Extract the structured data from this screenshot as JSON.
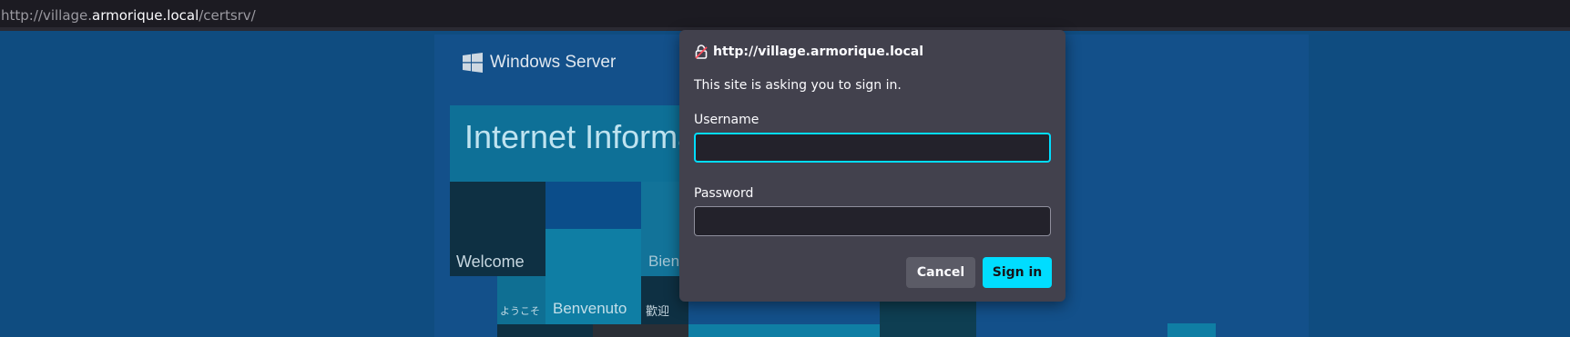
{
  "address_bar": {
    "url_prefix": "http://village.",
    "url_host": "armorique.local",
    "url_suffix": "/certsrv/"
  },
  "backdrop": {
    "brand": "Windows Server",
    "header": "Internet Information Services",
    "tiles": {
      "welcome": "Welcome",
      "bienvenue": "Bienvenue",
      "youkoso": "ようこそ",
      "benvenuto": "Benvenuto",
      "huanying": "歡迎"
    }
  },
  "auth_dialog": {
    "origin": "http://village.armorique.local",
    "message": "This site is asking you to sign in.",
    "username_label": "Username",
    "username_value": "",
    "password_label": "Password",
    "password_value": "",
    "cancel_label": "Cancel",
    "signin_label": "Sign in",
    "accent_color": "#00ddff"
  }
}
